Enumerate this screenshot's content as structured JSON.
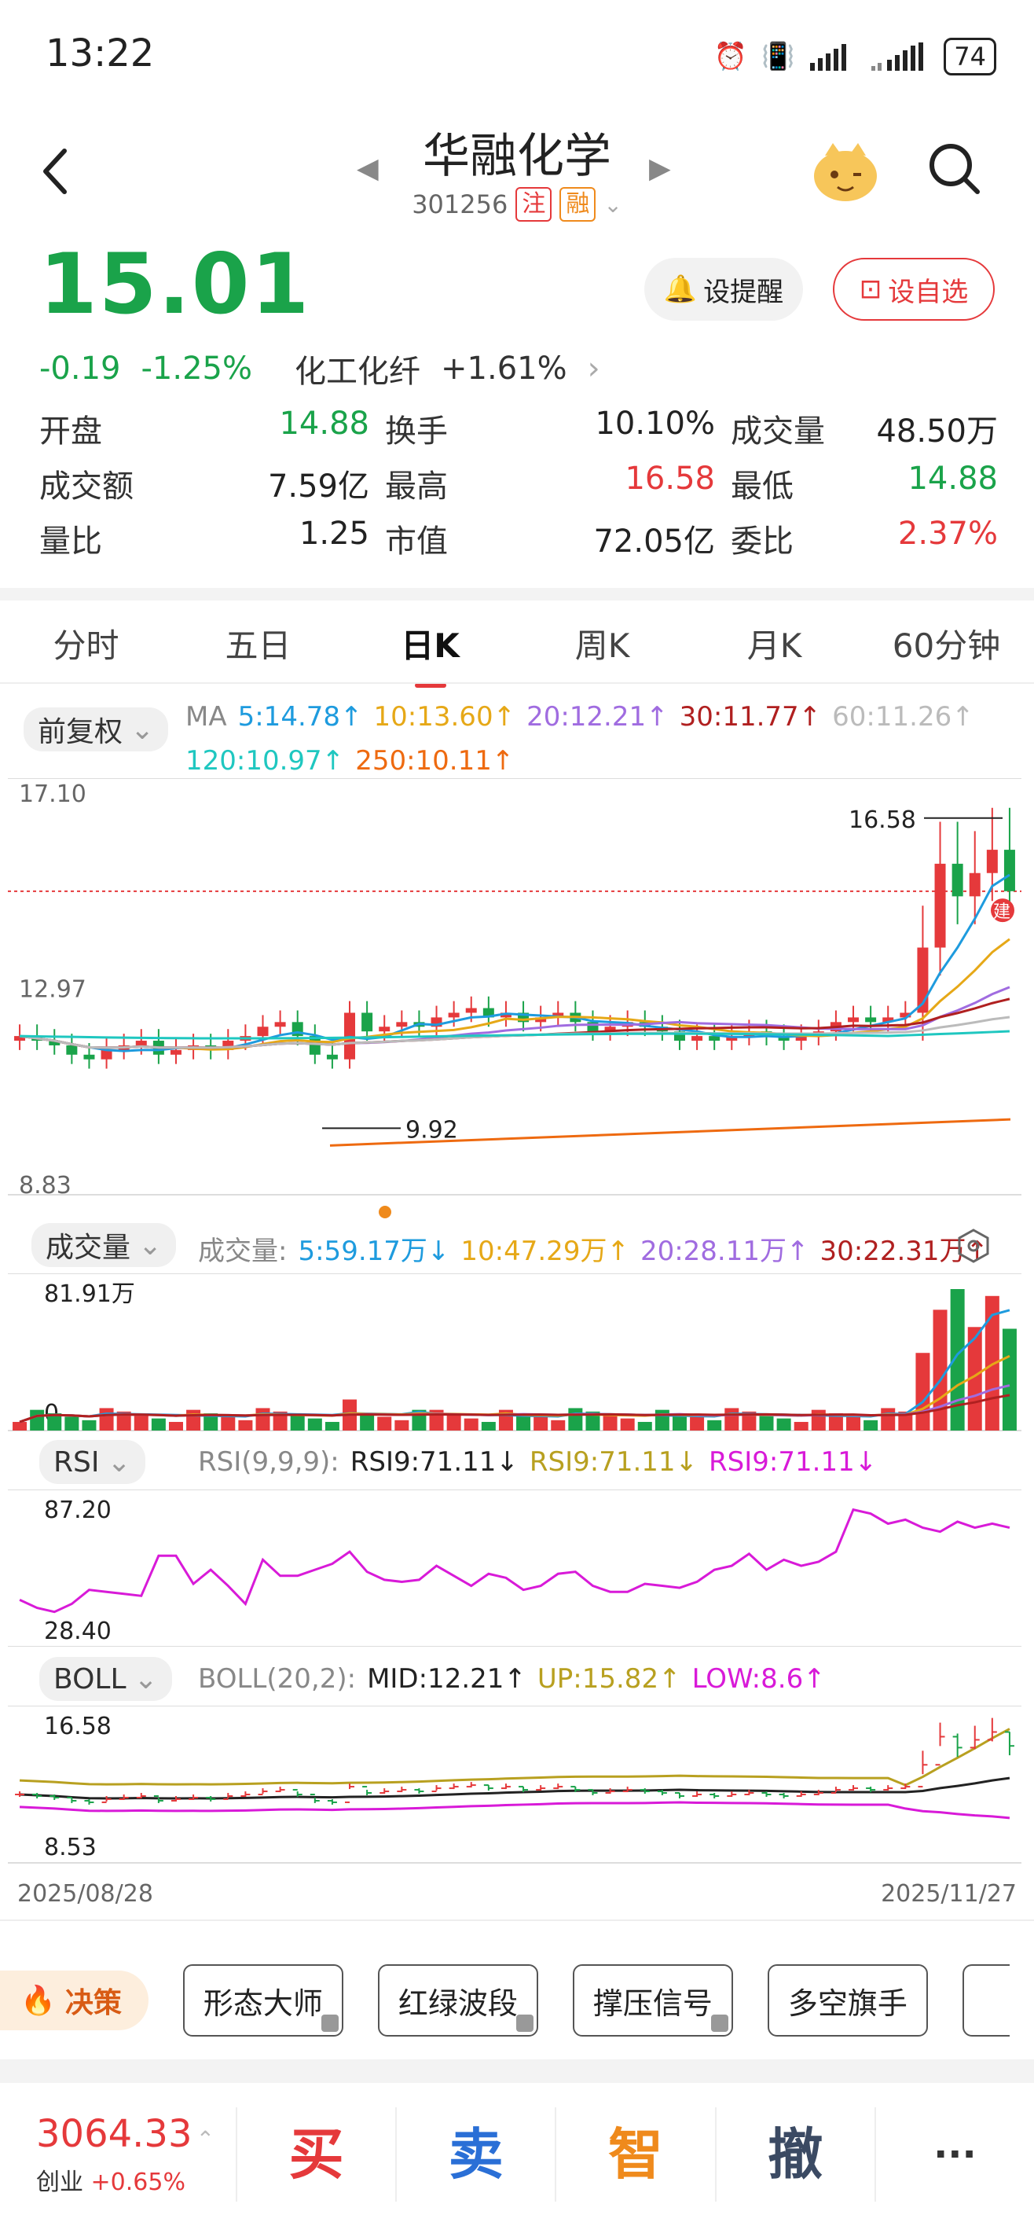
{
  "status_bar": {
    "time": "13:22",
    "battery": "74"
  },
  "header": {
    "stock_name": "华融化学",
    "stock_code": "301256",
    "tag1": "注",
    "tag2": "融"
  },
  "quote": {
    "price": "15.01",
    "change": "-0.19",
    "change_pct": "-1.25%",
    "sector": "化工化纤",
    "sector_change": "+1.61%",
    "alert_button": "设提醒",
    "fav_button": "设自选",
    "rows": [
      [
        {
          "k": "开盘",
          "v": "14.88",
          "c": "green"
        },
        {
          "k": "换手",
          "v": "10.10%",
          "c": "black"
        },
        {
          "k": "成交量",
          "v": "48.50万",
          "c": "black"
        }
      ],
      [
        {
          "k": "成交额",
          "v": "7.59亿",
          "c": "black"
        },
        {
          "k": "最高",
          "v": "16.58",
          "c": "red"
        },
        {
          "k": "最低",
          "v": "14.88",
          "c": "green"
        }
      ],
      [
        {
          "k": "量比",
          "v": "1.25",
          "c": "black"
        },
        {
          "k": "市值",
          "v": "72.05亿",
          "c": "black"
        },
        {
          "k": "委比",
          "v": "2.37%",
          "c": "red"
        }
      ]
    ]
  },
  "tabs": [
    "分时",
    "五日",
    "日K",
    "周K",
    "月K",
    "60分钟"
  ],
  "active_tab": "日K",
  "kline": {
    "adjust": "前复权",
    "ma_line1": [
      {
        "t": "MA",
        "color": "#888888"
      },
      {
        "t": "5:14.78↑",
        "color": "#1e9bde"
      },
      {
        "t": "10:13.60↑",
        "color": "#e6a817"
      },
      {
        "t": "20:12.21↑",
        "color": "#a06ce0"
      },
      {
        "t": "30:11.77↑",
        "color": "#b02020"
      },
      {
        "t": "60:11.26↑",
        "color": "#bbbbbb"
      }
    ],
    "ma_line2": [
      {
        "t": "120:10.97↑",
        "color": "#1fc7c0"
      },
      {
        "t": "250:10.11↑",
        "color": "#ee6a10"
      }
    ],
    "y_top": "17.10",
    "y_mid": "12.97",
    "y_bottom": "8.83",
    "high_label": "16.58",
    "low_label": "9.92",
    "build_badge": "建"
  },
  "volume": {
    "selector": "成交量",
    "legend": [
      {
        "t": "成交量:",
        "color": "#888888"
      },
      {
        "t": "5:59.17万↓",
        "color": "#1e9bde"
      },
      {
        "t": "10:47.29万↑",
        "color": "#e6a817"
      },
      {
        "t": "20:28.11万↑",
        "color": "#a06ce0"
      },
      {
        "t": "30:22.31万↑",
        "color": "#b02020"
      }
    ],
    "y_top": "81.91万",
    "y_bottom": "0"
  },
  "rsi": {
    "selector": "RSI",
    "legend": [
      {
        "t": "RSI(9,9,9):",
        "color": "#888888"
      },
      {
        "t": "RSI9:71.11↓",
        "color": "#222222"
      },
      {
        "t": "RSI9:71.11↓",
        "color": "#b8a020"
      },
      {
        "t": "RSI9:71.11↓",
        "color": "#d81ad8"
      }
    ],
    "y_top": "87.20",
    "y_bottom": "28.40"
  },
  "boll": {
    "selector": "BOLL",
    "legend": [
      {
        "t": "BOLL(20,2):",
        "color": "#888888"
      },
      {
        "t": "MID:12.21↑",
        "color": "#222222"
      },
      {
        "t": "UP:15.82↑",
        "color": "#b8a020"
      },
      {
        "t": "LOW:8.6↑",
        "color": "#d81ad8"
      }
    ],
    "y_top": "16.58",
    "y_bottom": "8.53",
    "date_start": "2025/08/28",
    "date_end": "2025/11/27"
  },
  "strategy": {
    "decide": "决策",
    "buttons": [
      "形态大师",
      "红绿波段",
      "撑压信号",
      "多空旗手"
    ]
  },
  "bottom_bar": {
    "index_value": "3064.33",
    "index_name": "创业",
    "index_change": "+0.65%",
    "actions": [
      "买",
      "卖",
      "智",
      "撤",
      "···"
    ]
  }
}
